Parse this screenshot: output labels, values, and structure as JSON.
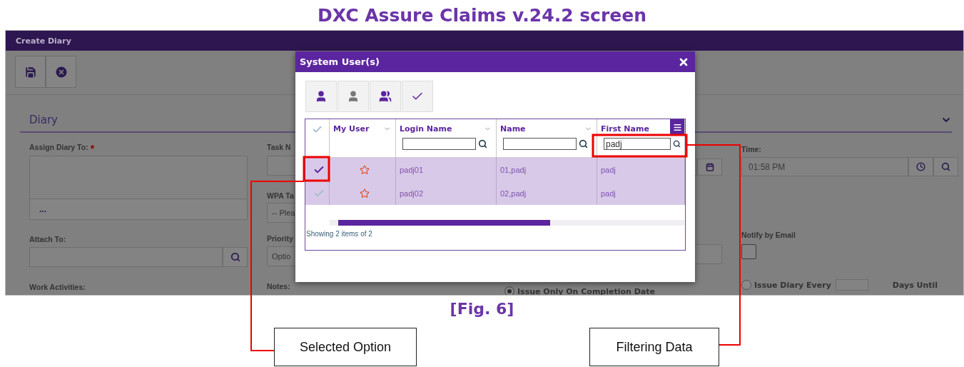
{
  "title": "DXC Assure Claims v.24.2 screen",
  "screen": {
    "header": "Create Diary",
    "section": {
      "title": "Diary"
    },
    "form": {
      "assign_diary_to": {
        "label": "Assign Diary To:",
        "required_mark": "*",
        "button": "..."
      },
      "task_name": {
        "label": "Task N"
      },
      "wpa_task": {
        "label": "WPA Ta",
        "value": "-- Plea"
      },
      "attach_to": {
        "label": "Attach To:"
      },
      "priority": {
        "label": "Priority",
        "value": "Optio"
      },
      "time": {
        "label": "Time:",
        "value": "01:58 PM"
      },
      "notify_by_email": {
        "label": "Notify by Email",
        "checked": false
      },
      "work_activities": {
        "label": "Work Activities:"
      },
      "notes": {
        "label": "Notes:"
      },
      "issue_options": [
        {
          "label": "Issue Only On Completion Date",
          "selected": true
        },
        {
          "label": "Issue Diary Every",
          "selected": false
        }
      ],
      "days_until": "Days Until"
    }
  },
  "modal": {
    "title": "System User(s)",
    "star_column": {
      "label": "My User"
    },
    "columns": [
      {
        "label": "Login Name"
      },
      {
        "label": "Name"
      },
      {
        "label": "First Name",
        "filter": "padj"
      }
    ],
    "rows": [
      {
        "selected": true,
        "starred": false,
        "cells": [
          "padj01",
          "01,padj",
          "padj"
        ]
      },
      {
        "selected": false,
        "starred": false,
        "cells": [
          "padj02",
          "02,padj",
          "padj"
        ]
      }
    ],
    "footer": "Showing 2 items of 2"
  },
  "caption": "[Fig. 6]",
  "callouts": [
    "Selected Option",
    "Filtering Data"
  ]
}
